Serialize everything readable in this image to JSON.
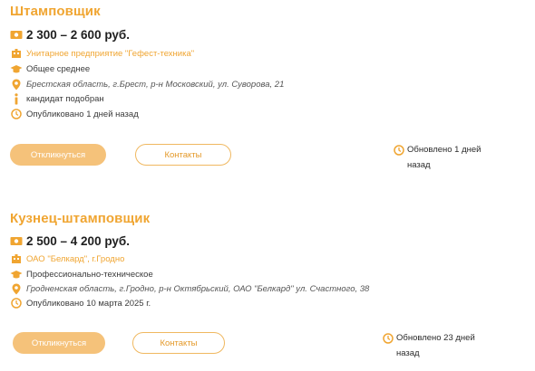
{
  "colors": {
    "accent": "#f0a531",
    "button_fill": "#f5c27a"
  },
  "vacancies": [
    {
      "title": "Штамповщик",
      "salary": "2 300 – 2 600 руб.",
      "employer": "Унитарное предприятие \"Гефест-техника\"",
      "education": "Общее среднее",
      "address": "Брестская область, г.Брест, р-н Московский, ул. Суворова, 21",
      "status": "кандидат подобран",
      "published": "Опубликовано 1 дней назад",
      "respond_label": "Откликнуться",
      "contacts_label": "Контакты",
      "updated_line1": "Обновлено 1 дней",
      "updated_line2": "назад"
    },
    {
      "title": "Кузнец-штамповщик",
      "salary": "2 500 – 4 200 руб.",
      "employer": "ОАО \"Белкард\", г.Гродно",
      "education": "Профессионально-техническое",
      "address": "Гродненская область, г.Гродно, р-н Октябрьский, ОАО \"Белкард\" ул. Счастного, 38",
      "published": "Опубликовано 10 марта 2025 г.",
      "respond_label": "Откликнуться",
      "contacts_label": "Контакты",
      "updated_line1": "Обновлено 23 дней",
      "updated_line2": "назад"
    }
  ]
}
